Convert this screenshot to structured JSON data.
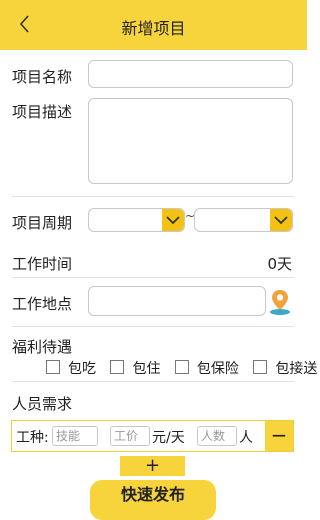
{
  "header": {
    "title": "新增项目"
  },
  "form": {
    "name_label": "项目名称",
    "desc_label": "项目描述",
    "period_label": "项目周期",
    "period_separator": "~",
    "work_time_label": "工作时间",
    "work_time_value": "0天",
    "location_label": "工作地点"
  },
  "welfare": {
    "label": "福利待遇",
    "options": [
      "包吃",
      "包住",
      "包保险",
      "包接送"
    ]
  },
  "staff": {
    "label": "人员需求",
    "type_label": "工种:",
    "skill_placeholder": "技能",
    "wage_placeholder": "工价",
    "wage_unit": "元/天",
    "count_placeholder": "人数",
    "count_unit": "人",
    "remove_symbol": "−",
    "add_symbol": "+"
  },
  "actions": {
    "publish_label": "快速发布"
  },
  "colors": {
    "accent": "#f7d33c",
    "border": "#c8c8c8",
    "location_icon": "#f2a23a"
  }
}
